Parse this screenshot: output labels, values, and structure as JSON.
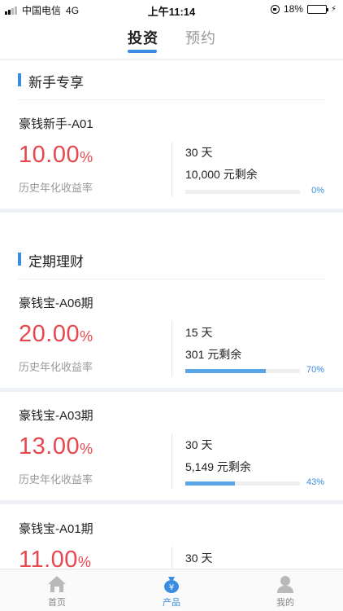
{
  "status_bar": {
    "carrier": "中国电信",
    "network": "4G",
    "time": "上午11:14",
    "battery": "18%",
    "battery_level": 0.18
  },
  "tabs": [
    {
      "label": "投资",
      "active": true
    },
    {
      "label": "预约",
      "active": false
    }
  ],
  "sections": {
    "newbie": {
      "title": "新手专享"
    },
    "fixed": {
      "title": "定期理财"
    }
  },
  "products": [
    {
      "name": "豪钱新手-A01",
      "rate": "10.00",
      "rate_unit": "%",
      "rate_label": "历史年化收益率",
      "term": "30 天",
      "remaining": "10,000 元剩余",
      "progress_label": "0%",
      "progress": 0.0
    },
    {
      "name": "豪钱宝-A06期",
      "rate": "20.00",
      "rate_unit": "%",
      "rate_label": "历史年化收益率",
      "term": "15 天",
      "remaining": "301 元剩余",
      "progress_label": "70%",
      "progress": 0.7
    },
    {
      "name": "豪钱宝-A03期",
      "rate": "13.00",
      "rate_unit": "%",
      "rate_label": "历史年化收益率",
      "term": "30 天",
      "remaining": "5,149 元剩余",
      "progress_label": "43%",
      "progress": 0.43
    },
    {
      "name": "豪钱宝-A01期",
      "rate": "11.00",
      "rate_unit": "%",
      "term": "30 天"
    }
  ],
  "bottom_nav": [
    {
      "label": "首页",
      "icon": "home-icon",
      "active": false
    },
    {
      "label": "产品",
      "icon": "money-bag-icon",
      "active": true
    },
    {
      "label": "我的",
      "icon": "user-icon",
      "active": false
    }
  ],
  "colors": {
    "accent": "#3a8de0",
    "rate": "#e8474d",
    "progress_fill": "#5aa5e6"
  }
}
